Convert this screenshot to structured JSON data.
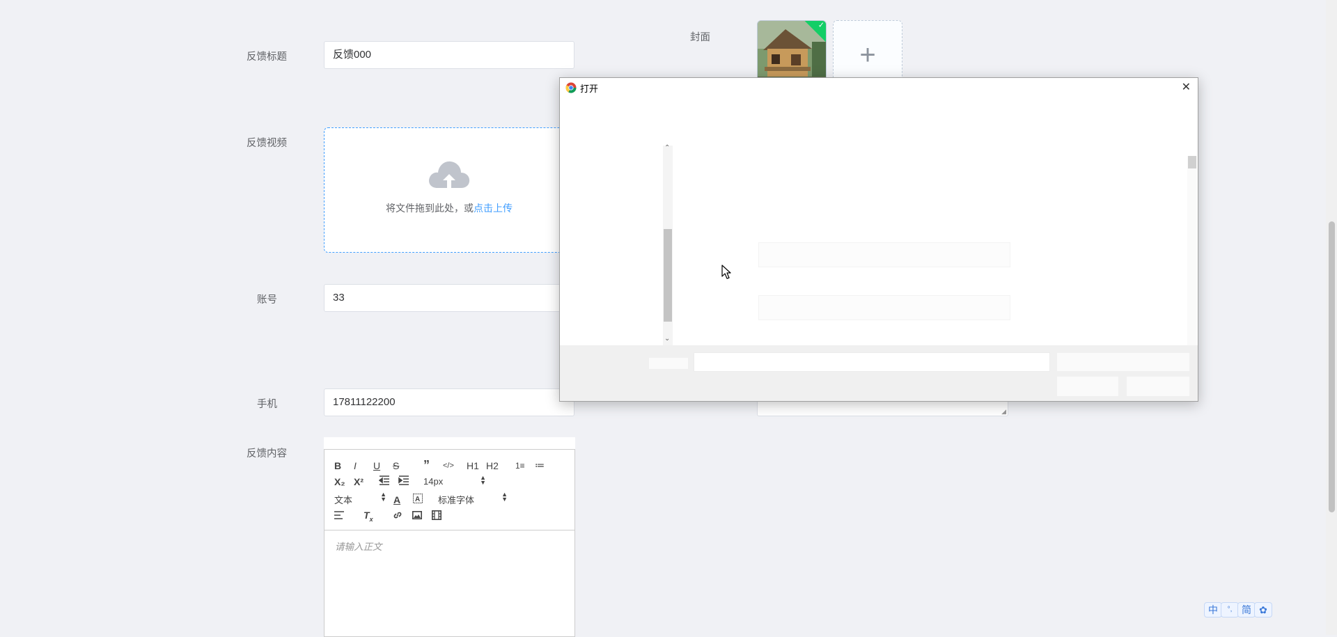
{
  "form": {
    "title_label": "反馈标题",
    "title_value": "反馈000",
    "video_label": "反馈视频",
    "upload_text": "将文件拖到此处，或",
    "upload_link": "点击上传",
    "account_label": "账号",
    "account_value": "33",
    "phone_label": "手机",
    "phone_value": "17811122200",
    "content_label": "反馈内容",
    "cover_label": "封面"
  },
  "editor": {
    "bold": "B",
    "italic": "I",
    "underline": "U",
    "strike": "S",
    "quote": "”",
    "code": "</>",
    "h1": "H1",
    "h2": "H2",
    "ordered_list": "1≡",
    "bullet_list": "≔",
    "subscript": "X₂",
    "superscript": "X²",
    "font_size": "14px",
    "header_select": "文本",
    "font_family": "标准字体",
    "placeholder": "请输入正文"
  },
  "dialog": {
    "title": "打开",
    "close": "✕"
  },
  "ime": [
    "中",
    "°,",
    "简",
    "✿"
  ]
}
